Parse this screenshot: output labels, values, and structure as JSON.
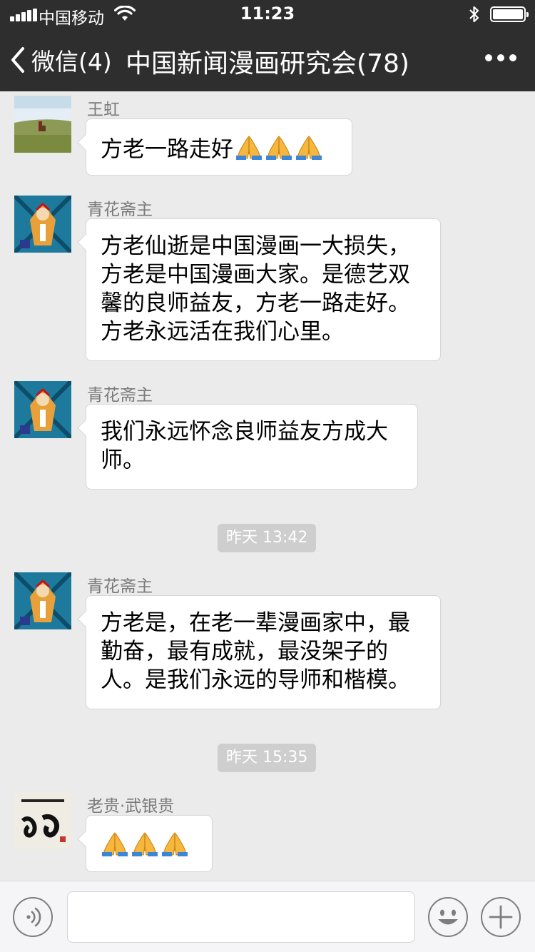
{
  "status_bar": {
    "carrier": "中国移动",
    "time": "11:23",
    "icons": [
      "signal-icon",
      "wifi-icon",
      "bluetooth-icon",
      "battery-icon"
    ]
  },
  "nav": {
    "back_label": "微信(4)",
    "title": "中国新闻漫画研究会(78)",
    "back_icon": "chevron-left-icon",
    "more_icon": "more-dots-icon"
  },
  "colors": {
    "nav_bg": "#2e2e2e",
    "chat_bg": "#ebebeb",
    "bubble_bg": "#ffffff",
    "timestamp_bg": "#cecece"
  },
  "messages": [
    {
      "sender": "王虹",
      "text": "方老一路走好",
      "emoji_count": 3
    },
    {
      "sender": "青花斋主",
      "text": "方老仙逝是中国漫画一大损失，方老是中国漫画大家。是德艺双馨的良师益友，方老一路走好。方老永远活在我们心里。"
    },
    {
      "sender": "青花斋主",
      "text": "我们永远怀念良师益友方成大师。"
    },
    {
      "sender": "青花斋主",
      "text": "方老是，在老一辈漫画家中，最勤奋，最有成就，最没架子的人。是我们永远的导师和楷模。"
    },
    {
      "sender": "老贵·武银贵",
      "text": "",
      "emoji_count": 3
    }
  ],
  "timestamps": [
    "昨天 13:42",
    "昨天 15:35"
  ],
  "input_bar": {
    "voice_icon": "voice-icon",
    "emoji_icon": "smiley-icon",
    "plus_icon": "plus-icon",
    "value": ""
  }
}
